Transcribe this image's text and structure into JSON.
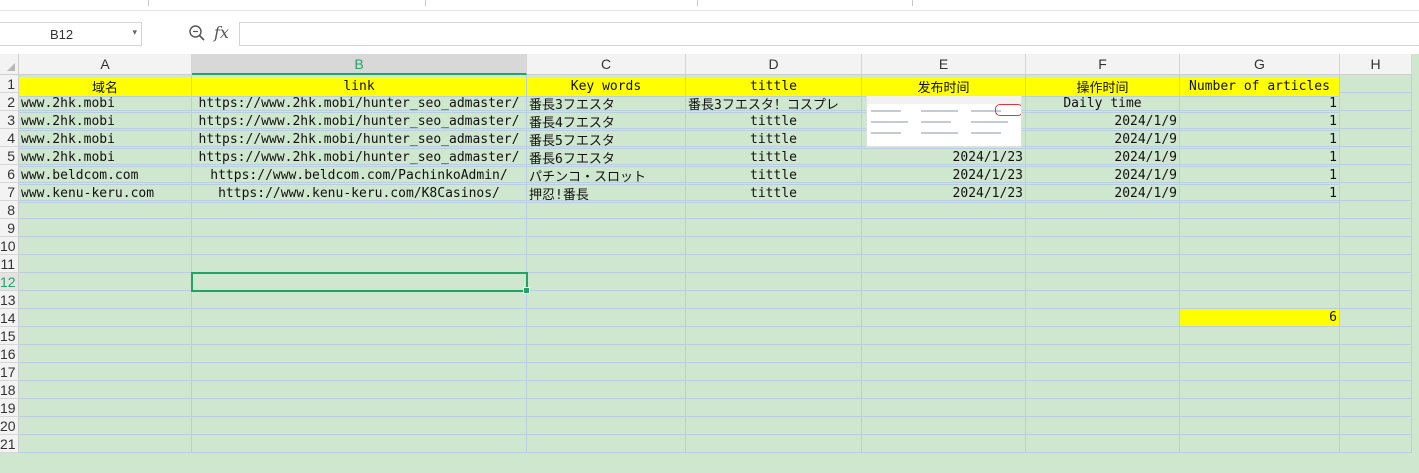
{
  "name_box": {
    "value": "B12"
  },
  "formula_bar": {
    "fx_label": "fx",
    "value": ""
  },
  "columns": [
    "A",
    "B",
    "C",
    "D",
    "E",
    "F",
    "G",
    "H"
  ],
  "rows": [
    "1",
    "2",
    "3",
    "4",
    "5",
    "6",
    "7",
    "8",
    "9",
    "10",
    "11",
    "12",
    "13",
    "14",
    "15",
    "16",
    "17",
    "18",
    "19",
    "20",
    "21"
  ],
  "selected_cell": "B12",
  "header_row": {
    "A": "域名",
    "B": "link",
    "C": "Key words",
    "D": "tittle",
    "E": "发布时间",
    "F": "操作时间",
    "G": "Number of articles"
  },
  "table_rows": [
    {
      "A": "www.2hk.mobi",
      "B": "https://www.2hk.mobi/hunter_seo_admaster/",
      "C": "番長3フエスタ",
      "D": "番長3フエスタ！コスプレ",
      "E": "",
      "F": "Daily time",
      "G": "1"
    },
    {
      "A": "www.2hk.mobi",
      "B": "https://www.2hk.mobi/hunter_seo_admaster/",
      "C": "番長4フエスタ",
      "D": "tittle",
      "E": "",
      "F": "2024/1/9",
      "G": "1"
    },
    {
      "A": "www.2hk.mobi",
      "B": "https://www.2hk.mobi/hunter_seo_admaster/",
      "C": "番長5フエスタ",
      "D": "tittle",
      "E": "",
      "F": "2024/1/9",
      "G": "1"
    },
    {
      "A": "www.2hk.mobi",
      "B": "https://www.2hk.mobi/hunter_seo_admaster/",
      "C": "番長6フエスタ",
      "D": "tittle",
      "E": "2024/1/23",
      "F": "2024/1/9",
      "G": "1"
    },
    {
      "A": "www.beldcom.com",
      "B": "https://www.beldcom.com/PachinkoAdmin/",
      "C": "パチンコ・スロット",
      "D": "tittle",
      "E": "2024/1/23",
      "F": "2024/1/9",
      "G": "1"
    },
    {
      "A": "www.kenu-keru.com",
      "B": "https://www.kenu-keru.com/K8Casinos/",
      "C": "押忍!番長",
      "D": "tittle",
      "E": "2024/1/23",
      "F": "2024/1/9",
      "G": "1"
    }
  ],
  "total_cell": {
    "ref": "G14",
    "value": "6"
  },
  "colors": {
    "grid_bg": "#cfe6cf",
    "header_fill": "#ffff00",
    "selection": "#21a366"
  },
  "icons": {
    "zoom": "magnifier-icon",
    "dropdown": "chevron-down-icon"
  }
}
